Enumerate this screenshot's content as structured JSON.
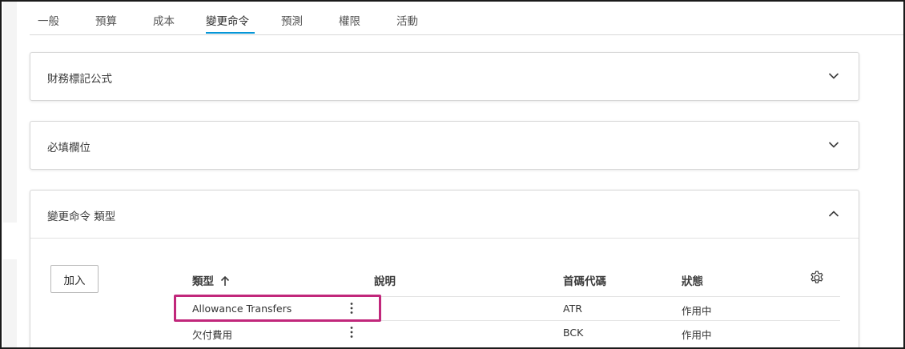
{
  "tabs": [
    {
      "label": "一般"
    },
    {
      "label": "預算"
    },
    {
      "label": "成本"
    },
    {
      "label": "變更命令"
    },
    {
      "label": "預測"
    },
    {
      "label": "權限"
    },
    {
      "label": "活動"
    }
  ],
  "active_tab": "變更命令",
  "accent_color": "#0696d7",
  "highlight_color": "#c1277b",
  "panels": [
    {
      "title": "財務標記公式",
      "expanded": false
    },
    {
      "title": "必填欄位",
      "expanded": false
    },
    {
      "title": "變更命令 類型",
      "expanded": true
    }
  ],
  "change_order_types": {
    "add_label": "加入",
    "columns": {
      "type": "類型",
      "description": "說明",
      "prefix": "首碼代碼",
      "status": "狀態"
    },
    "sort_icon": "arrow-up-icon",
    "settings_icon": "gear-icon",
    "rows": [
      {
        "type": "Allowance Transfers",
        "description": "",
        "prefix": "ATR",
        "status": "作用中",
        "menu_icon": "more-vertical-icon"
      },
      {
        "type": "欠付費用",
        "description": "",
        "prefix": "BCK",
        "status": "作用中",
        "menu_icon": "more-vertical-icon"
      }
    ]
  }
}
